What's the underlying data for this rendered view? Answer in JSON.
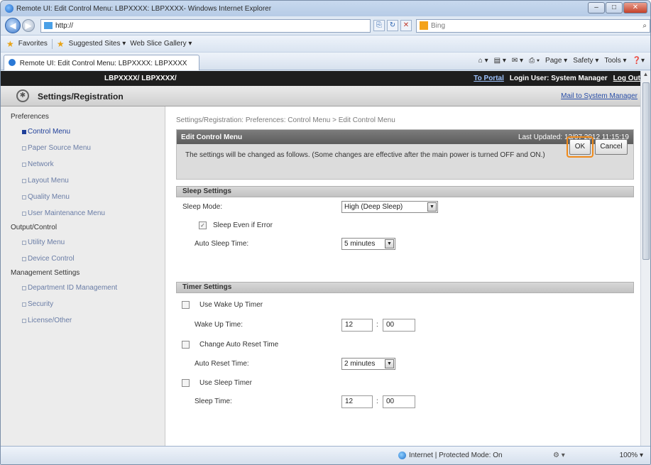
{
  "window": {
    "title": "Remote UI: Edit Control Menu: LBPXXXX: LBPXXXX- Windows Internet Explorer"
  },
  "address": {
    "url": "http://",
    "search_placeholder": "Bing"
  },
  "favorites": {
    "label": "Favorites",
    "items": [
      "Suggested Sites ▾",
      "Web Slice Gallery ▾"
    ]
  },
  "tab": {
    "title": "Remote UI: Edit Control Menu: LBPXXXX: LBPXXXX"
  },
  "command_bar": [
    "Page ▾",
    "Safety ▾",
    "Tools ▾"
  ],
  "rui": {
    "model": "LBPXXXX/ LBPXXXX/",
    "to_portal": "To Portal",
    "login_user": "Login User: System Manager",
    "log_out": "Log Out",
    "page_title": "Settings/Registration",
    "mail_link": "Mail to System Manager"
  },
  "sidebar": {
    "groups": [
      {
        "label": "Preferences",
        "items": [
          "Control Menu",
          "Paper Source Menu",
          "Network",
          "Layout Menu",
          "Quality Menu",
          "User Maintenance Menu"
        ]
      },
      {
        "label": "Output/Control",
        "items": [
          "Utility Menu",
          "Device Control"
        ]
      },
      {
        "label": "Management Settings",
        "items": [
          "Department ID Management",
          "Security",
          "License/Other"
        ]
      }
    ]
  },
  "main": {
    "breadcrumb": "Settings/Registration: Preferences: Control Menu > Edit Control Menu",
    "panel_title": "Edit Control Menu",
    "last_updated": "Last Updated: 13/07 2012 11:15:19",
    "message": "The settings will be changed as follows. (Some changes are effective after the main power is turned OFF and ON.)",
    "ok": "OK",
    "cancel": "Cancel",
    "sleep_section": "Sleep Settings",
    "sleep_mode_label": "Sleep Mode:",
    "sleep_mode_value": "High (Deep Sleep)",
    "sleep_even_error": "Sleep Even if Error",
    "auto_sleep_label": "Auto Sleep Time:",
    "auto_sleep_value": "5 minutes",
    "timer_section": "Timer Settings",
    "use_wake_timer": "Use Wake Up Timer",
    "wake_time_label": "Wake Up Time:",
    "wake_hour": "12",
    "wake_min": "00",
    "change_auto_reset": "Change Auto Reset Time",
    "auto_reset_label": "Auto Reset Time:",
    "auto_reset_value": "2 minutes",
    "use_sleep_timer": "Use Sleep Timer",
    "sleep_time_label": "Sleep Time:",
    "sleep_hour": "12",
    "sleep_min": "00",
    "colon": ":"
  },
  "status": {
    "zone": "Internet | Protected Mode: On",
    "zoom": "100% ▾"
  }
}
